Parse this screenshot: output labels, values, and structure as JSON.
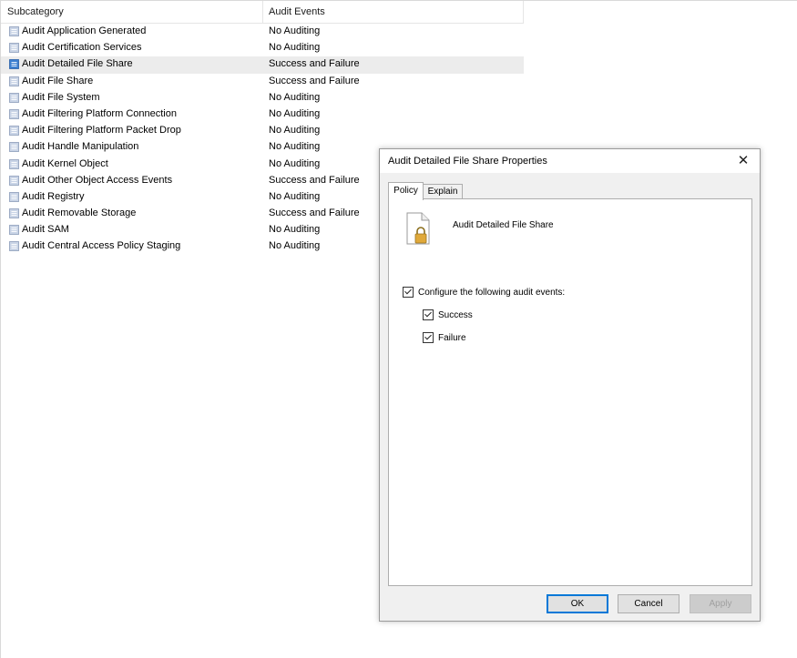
{
  "list": {
    "columns": {
      "subcategory": "Subcategory",
      "audit_events": "Audit Events"
    },
    "rows": [
      {
        "name": "Audit Application Generated",
        "events": "No Auditing"
      },
      {
        "name": "Audit Certification Services",
        "events": "No Auditing"
      },
      {
        "name": "Audit Detailed File Share",
        "events": "Success and Failure",
        "selected": true
      },
      {
        "name": "Audit File Share",
        "events": "Success and Failure"
      },
      {
        "name": "Audit File System",
        "events": "No Auditing"
      },
      {
        "name": "Audit Filtering Platform Connection",
        "events": "No Auditing"
      },
      {
        "name": "Audit Filtering Platform Packet Drop",
        "events": "No Auditing"
      },
      {
        "name": "Audit Handle Manipulation",
        "events": "No Auditing"
      },
      {
        "name": "Audit Kernel Object",
        "events": "No Auditing"
      },
      {
        "name": "Audit Other Object Access Events",
        "events": "Success and Failure"
      },
      {
        "name": "Audit Registry",
        "events": "No Auditing"
      },
      {
        "name": "Audit Removable Storage",
        "events": "Success and Failure"
      },
      {
        "name": "Audit SAM",
        "events": "No Auditing"
      },
      {
        "name": "Audit Central Access Policy Staging",
        "events": "No Auditing"
      }
    ]
  },
  "dialog": {
    "title": "Audit Detailed File Share Properties",
    "close_icon": "close-icon",
    "tabs": {
      "policy": "Policy",
      "explain": "Explain"
    },
    "policy_name": "Audit Detailed File Share",
    "configure_label": "Configure the following audit events:",
    "configure_checked": true,
    "success_label": "Success",
    "success_checked": true,
    "failure_label": "Failure",
    "failure_checked": true,
    "buttons": {
      "ok": "OK",
      "cancel": "Cancel",
      "apply": "Apply"
    }
  },
  "colors": {
    "accent": "#0078d7",
    "selection": "#ececec",
    "dialog_bg": "#f0f0f0"
  }
}
